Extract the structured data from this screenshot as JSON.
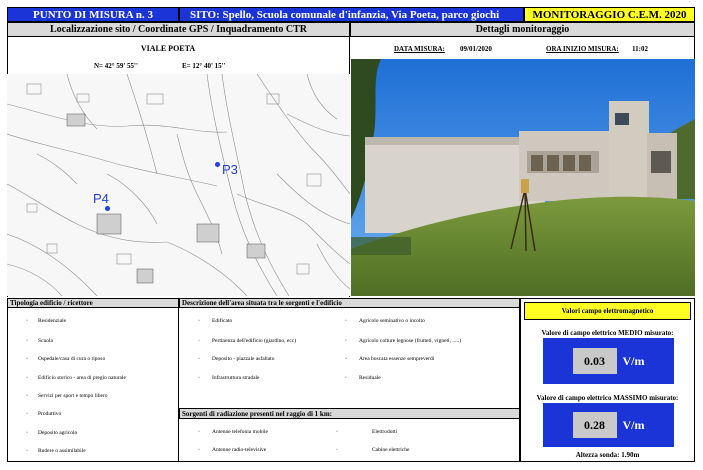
{
  "header": {
    "point": "PUNTO DI MISURA n. 3",
    "site": "SITO: Spello, Scuola comunale d'infanzia, Via Poeta, parco giochi",
    "campaign": "MONITORAGGIO C.E.M. 2020"
  },
  "location": {
    "title": "Localizzazione sito / Coordinate GPS / Inquadramento CTR",
    "street": "VIALE POETA",
    "north": "N=  42° 59' 55''",
    "east": "E=  12° 40' 15''",
    "map_labels": [
      "P3",
      "P4"
    ]
  },
  "monitoring": {
    "title": "Dettagli monitoraggio",
    "date_label": "DATA MISURA:",
    "date_value": "09/01/2020",
    "time_label": "ORA INIZIO MISURA:",
    "time_value": "11:02"
  },
  "building_type": {
    "title": "Tipologia edificio / ricettore",
    "items": [
      "Residenziale",
      "Scuola",
      "Ospedale/casa di cura o riposo",
      "Edificio storico - area di pregio naturale",
      "Servizi per sport e tempo libero",
      "Produttivo",
      "Deposito agricolo",
      "Rudere o assimilabile"
    ]
  },
  "area_description": {
    "title": "Descrizione dell'area situata tra le sorgenti e l'edificio",
    "col1": [
      "Edificato",
      "Pertinenza dell'edificio (giardino, ecc)",
      "Deposito - piazzale asfaltato",
      "Infrastruttura stradale"
    ],
    "col2": [
      "Agricolo seminativo o incolto",
      "Agricolo colture legnose (frutteti, vigneti, .....)",
      "Area boscata essenze sempreverdi",
      "Residuale"
    ]
  },
  "sources": {
    "title": "Sorgenti di radiazione presenti nel raggio di 1 km:",
    "col1": [
      "Antenne telefonia mobile",
      "Antenne radio-televisive"
    ],
    "col2": [
      "Elettrodotti",
      "Cabine elettriche"
    ]
  },
  "field": {
    "title": "Valori campo elettromagnetico",
    "mean_label": "Valore di campo elettrico MEDIO misurato:",
    "mean_value": "0.03",
    "max_label": "Valore di campo elettrico MASSIMO misurato:",
    "max_value": "0.28",
    "unit": "V/m",
    "probe": "Altezza sonda: 1.90m"
  },
  "checkbox_glyph": "▫",
  "colors": {
    "header_blue": "#1a34d8",
    "header_yellow": "#ffff22",
    "section_grey": "#d9d9d9",
    "map_marker": "#1f3fe0"
  }
}
